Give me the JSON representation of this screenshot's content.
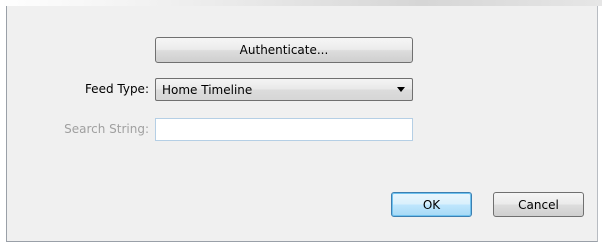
{
  "dialog": {
    "authenticate_label": "Authenticate...",
    "feed_type": {
      "label": "Feed Type:",
      "selected": "Home Timeline"
    },
    "search": {
      "label": "Search String:",
      "value": "",
      "placeholder": ""
    },
    "ok_label": "OK",
    "cancel_label": "Cancel"
  },
  "colors": {
    "dialog_bg": "#f0f0f0",
    "disabled_text": "#a0a0a0",
    "ok_accent": "#3c7fb1"
  },
  "icons": {
    "dropdown": "chevron-down-icon"
  }
}
